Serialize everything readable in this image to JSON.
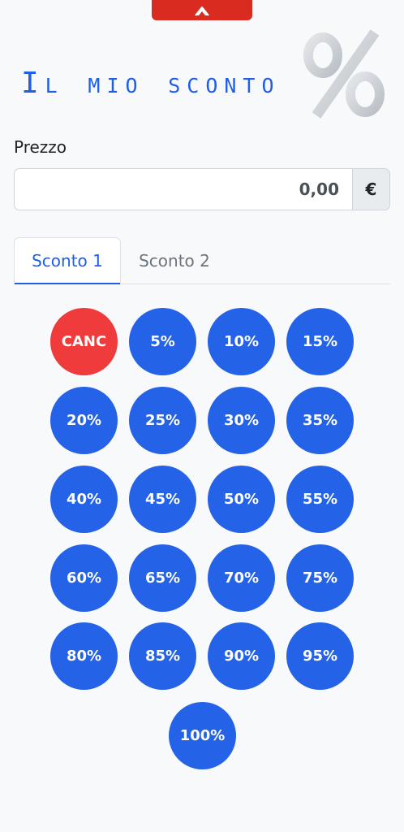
{
  "top_tab": {
    "icon": "chevron-up-icon"
  },
  "header": {
    "title": "Il mio sconto",
    "logo_symbol": "%"
  },
  "price": {
    "label": "Prezzo",
    "value": "0,00",
    "currency": "€"
  },
  "tabs": [
    {
      "label": "Sconto 1",
      "active": true
    },
    {
      "label": "Sconto 2",
      "active": false
    }
  ],
  "buttons": {
    "cancel": "CANC",
    "percentages": [
      "5%",
      "10%",
      "15%",
      "20%",
      "25%",
      "30%",
      "35%",
      "40%",
      "45%",
      "50%",
      "55%",
      "60%",
      "65%",
      "70%",
      "75%",
      "80%",
      "85%",
      "90%",
      "95%",
      "100%"
    ]
  },
  "colors": {
    "primary": "#2462e8",
    "cancel": "#ef3b3b",
    "top_tab": "#d92b20",
    "background": "#f8f9fa"
  }
}
